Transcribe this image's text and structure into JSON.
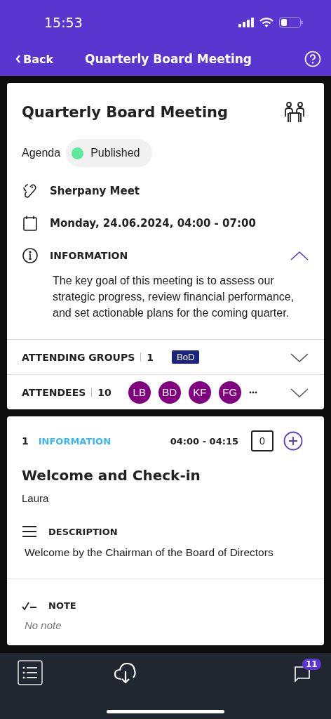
{
  "status_bar": {
    "time": "15:53"
  },
  "nav_bar": {
    "back": "Back",
    "title": "Quarterly Board Meeting"
  },
  "meeting": {
    "title": "Quarterly Board Meeting",
    "agenda_label": "Agenda",
    "agenda_status": {
      "label": "Published",
      "color": "#5de89a"
    },
    "location": "Sherpany Meet",
    "date": "Monday, 24.06.2024, 04:00 - 07:00",
    "information": {
      "heading": "INFORMATION",
      "expanded": true,
      "text": "The key goal of this meeting is to assess our strategic progress, review financial performance, and set actionable plans for the coming quarter."
    },
    "attending_groups": {
      "label": "ATTENDING GROUPS",
      "count": "1",
      "groups": [
        "BoD"
      ],
      "expanded": false
    },
    "attendees": {
      "label": "ATTENDEES",
      "count": "10",
      "initials": [
        "LB",
        "BD",
        "KF",
        "FG"
      ],
      "more": true,
      "expanded": false
    }
  },
  "agenda_items": [
    {
      "number": "1",
      "type": "INFORMATION",
      "time": "04:00 - 04:15",
      "comments": "0",
      "title": "Welcome and Check-in",
      "presenter": "Laura",
      "description_heading": "DESCRIPTION",
      "description": "Welcome by the Chairman of the Board of Directors",
      "note_heading": "NOTE",
      "note": "No note"
    }
  ],
  "tab_bar": {
    "comments_badge": "11"
  }
}
